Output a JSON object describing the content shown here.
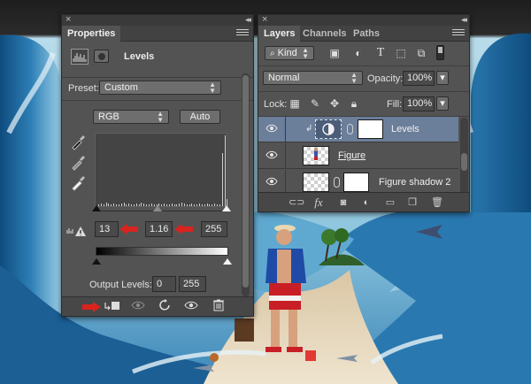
{
  "properties_panel": {
    "tab_label": "Properties",
    "adjustment_title": "Levels",
    "preset_label": "Preset:",
    "preset_value": "Custom",
    "channel_value": "RGB",
    "auto_button": "Auto",
    "input_levels": {
      "black": "13",
      "gamma": "1.16",
      "white": "255"
    },
    "output_levels_label": "Output Levels:",
    "output_levels": {
      "black": "0",
      "white": "255"
    },
    "bottom_buttons": [
      "clip-to-layer",
      "view-previous",
      "reset",
      "visibility",
      "delete"
    ]
  },
  "layers_panel": {
    "tabs": [
      "Layers",
      "Channels",
      "Paths"
    ],
    "active_tab": "Layers",
    "filter_kind": "Kind",
    "filter_icons": [
      "image-filter-icon",
      "adjustment-filter-icon",
      "type-filter-icon",
      "shape-filter-icon",
      "smart-object-filter-icon"
    ],
    "blend_mode": "Normal",
    "opacity_label": "Opacity:",
    "opacity_value": "100%",
    "lock_label": "Lock:",
    "fill_label": "Fill:",
    "fill_value": "100%",
    "layers": [
      {
        "name": "Levels",
        "type": "adjustment",
        "selected": true,
        "clipped": true
      },
      {
        "name": "Figure",
        "type": "pixel",
        "selected": false,
        "clipped": false
      },
      {
        "name": "Figure shadow 2",
        "type": "masked-pixel",
        "selected": false,
        "clipped": false
      }
    ],
    "bottom_icons": [
      "link-layers-icon",
      "fx-icon",
      "add-mask-icon",
      "new-adjustment-icon",
      "new-group-icon",
      "new-layer-icon",
      "trash-icon"
    ],
    "fx_label": "fx"
  },
  "colors": {
    "panel_bg": "#535353",
    "selected_layer": "#6b7e9a",
    "annotation_arrow": "#d9231f",
    "water": "#2a6fa3"
  }
}
